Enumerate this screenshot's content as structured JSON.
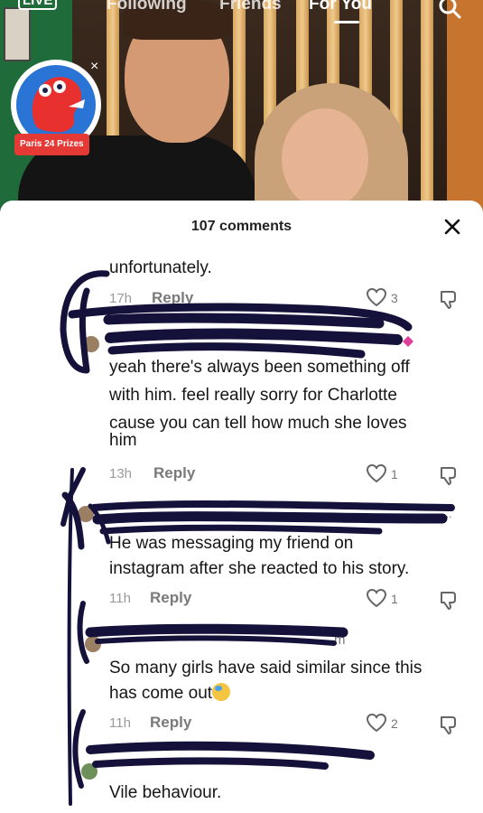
{
  "topnav": {
    "live": "LIVE",
    "following": "Following",
    "friends": "Friends",
    "for_you": "For You"
  },
  "prize_badge": {
    "label": "Paris 24 Prizes",
    "close": "×"
  },
  "comments_panel": {
    "title": "107 comments",
    "comments": [
      {
        "text_lines": [
          "unfortunately."
        ],
        "time": "17h",
        "reply": "Reply",
        "likes": "3"
      },
      {
        "username": "",
        "text_lines": [
          "yeah there's always been something off",
          "with him. feel really sorry for Charlotte",
          "cause you can tell how much she loves",
          "him"
        ],
        "time": "13h",
        "reply": "Reply",
        "likes": "1"
      },
      {
        "username": "...",
        "text_lines": [
          "He was messaging my friend on",
          "instagram after she reacted to his story."
        ],
        "time": "11h",
        "reply": "Reply",
        "likes": "1"
      },
      {
        "username": "m",
        "text_lines": [
          "So many girls have said similar since this",
          "has come out"
        ],
        "time": "11h",
        "reply": "Reply",
        "likes": "2"
      },
      {
        "username": "",
        "text_lines": [
          "Vile behaviour."
        ]
      }
    ]
  },
  "colors": {
    "scribble": "#14123a",
    "brand_red": "#e53935",
    "badge_blue": "#2a74d6"
  },
  "icons": [
    "search-icon",
    "close-icon",
    "heart-icon",
    "dislike-icon",
    "mascot-icon",
    "emoji-icon"
  ]
}
